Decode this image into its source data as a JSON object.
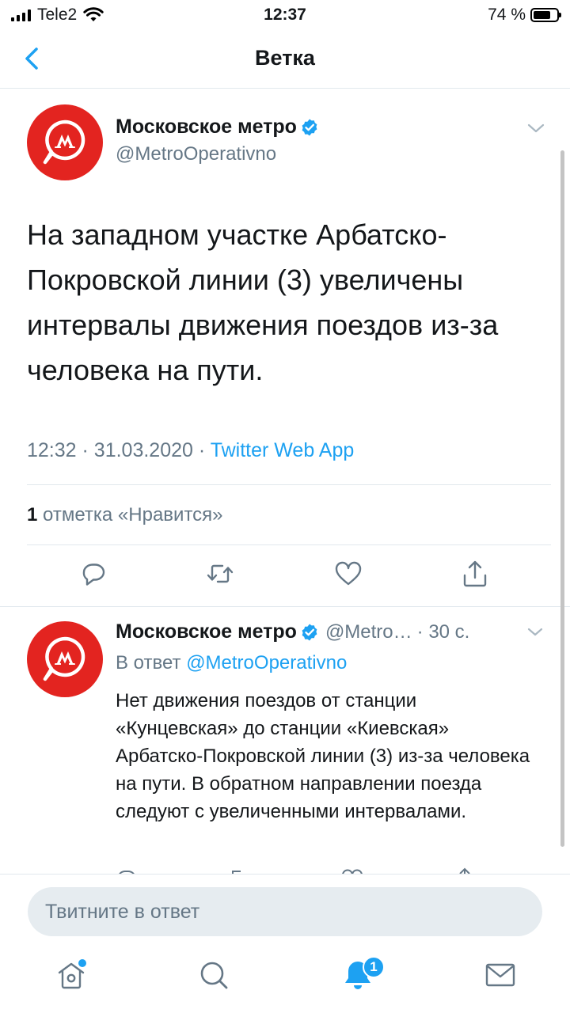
{
  "status_bar": {
    "carrier": "Tele2",
    "time": "12:37",
    "battery": "74 %",
    "battery_level": 0.74
  },
  "nav": {
    "title": "Ветка"
  },
  "main_tweet": {
    "display_name": "Московское метро",
    "handle": "@MetroOperativno",
    "text": "На западном участке Арбатско-Покровской линии (3) увеличены интервалы движения поездов из-за человека на пути.",
    "time": "12:32",
    "separator": "·",
    "date": "31.03.2020",
    "app": "Twitter Web App",
    "likes_count": "1",
    "likes_label": "отметка «Нравится»"
  },
  "reply_tweet": {
    "display_name": "Московское метро",
    "handle": "@Metro…",
    "age": "· 30 с.",
    "in_reply_label": "В ответ",
    "in_reply_mention": "@MetroOperativno",
    "text": "Нет движения поездов от станции «Кунцевская» до станции «Киевская» Арбатско-Покровской линии (3) из-за человека на пути. В обратном направлении поезда следуют с увеличенными интервалами."
  },
  "compose": {
    "placeholder": "Твитните в ответ"
  },
  "tabbar": {
    "notifications_badge": "1"
  },
  "icons": {
    "back": "chevron-left-icon",
    "verified": "verified-badge-icon",
    "more": "chevron-down-icon",
    "reply": "reply-icon",
    "retweet": "retweet-icon",
    "like": "heart-icon",
    "share": "share-icon",
    "home": "home-icon",
    "search": "search-icon",
    "notifications": "bell-icon",
    "messages": "envelope-icon"
  },
  "colors": {
    "accent": "#1da1f2",
    "brand_red": "#e32420",
    "secondary_text": "#657786",
    "divider": "#e1e8ed",
    "compose_bg": "#e6ecf0"
  }
}
